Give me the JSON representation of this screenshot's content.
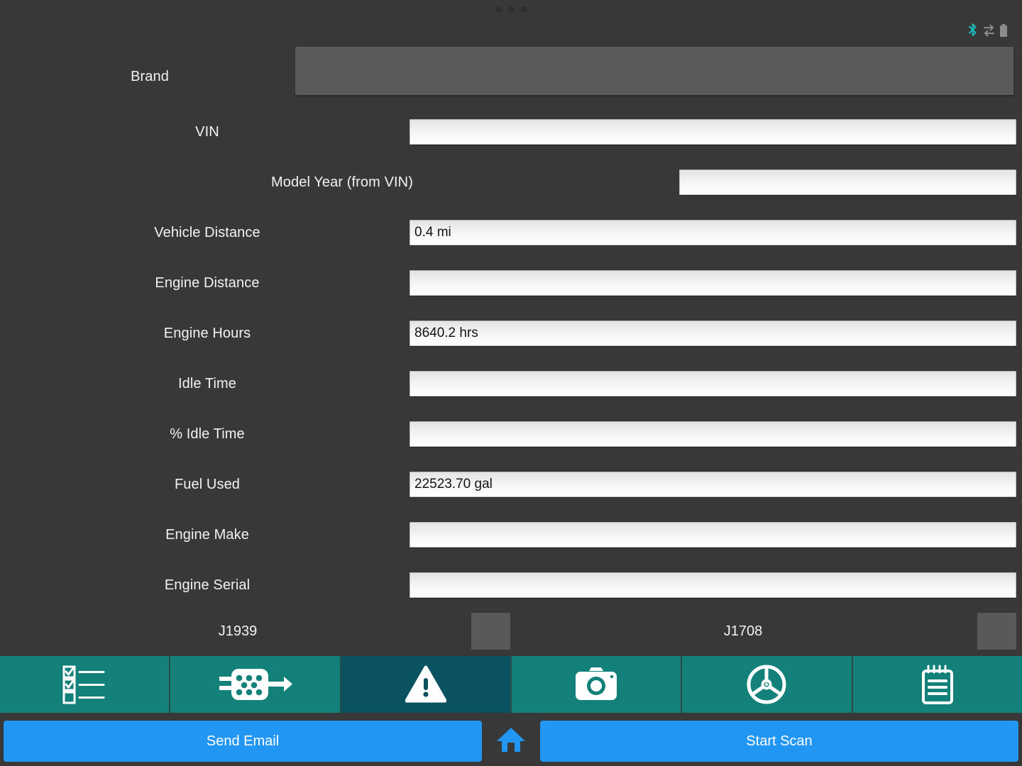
{
  "titlebar": {
    "handle_icon": "drag-handle-dots"
  },
  "statusbar": {
    "bluetooth_icon": "bluetooth-icon",
    "bluetooth_color": "#17b8b8",
    "data_transfer_icon": "data-transfer-icon",
    "battery_icon": "battery-icon"
  },
  "colors": {
    "background": "#383838",
    "tab_teal": "#14807a",
    "tab_selected": "#0b5260",
    "action_blue": "#2196f3",
    "brand_box": "#5a5a5a",
    "proto_box": "#595959"
  },
  "form": {
    "fields": [
      {
        "label": "Brand",
        "value": "",
        "type": "dropdown"
      },
      {
        "label": "VIN",
        "value": "",
        "type": "text"
      },
      {
        "label": "Model Year (from VIN)",
        "value": "",
        "type": "text"
      },
      {
        "label": "Vehicle Distance",
        "value": "0.4 mi",
        "type": "text"
      },
      {
        "label": "Engine Distance",
        "value": "",
        "type": "text"
      },
      {
        "label": "Engine Hours",
        "value": "8640.2 hrs",
        "type": "text"
      },
      {
        "label": "Idle Time",
        "value": "",
        "type": "text"
      },
      {
        "label": "% Idle Time",
        "value": "",
        "type": "text"
      },
      {
        "label": "Fuel Used",
        "value": "22523.70 gal",
        "type": "text"
      },
      {
        "label": "Engine Make",
        "value": "",
        "type": "text"
      },
      {
        "label": "Engine Serial",
        "value": "",
        "type": "text"
      }
    ],
    "protocols": [
      {
        "label": "J1939",
        "indicator": ""
      },
      {
        "label": "J1708",
        "indicator": ""
      }
    ]
  },
  "tabbar": {
    "tabs": [
      {
        "icon": "checklist-icon",
        "selected": false
      },
      {
        "icon": "connector-icon",
        "selected": false
      },
      {
        "icon": "warning-icon",
        "selected": true
      },
      {
        "icon": "camera-icon",
        "selected": false
      },
      {
        "icon": "wheel-icon",
        "selected": false
      },
      {
        "icon": "notepad-icon",
        "selected": false
      }
    ]
  },
  "actionbar": {
    "send_email_label": "Send Email",
    "home_icon": "home-icon",
    "start_scan_label": "Start Scan"
  }
}
